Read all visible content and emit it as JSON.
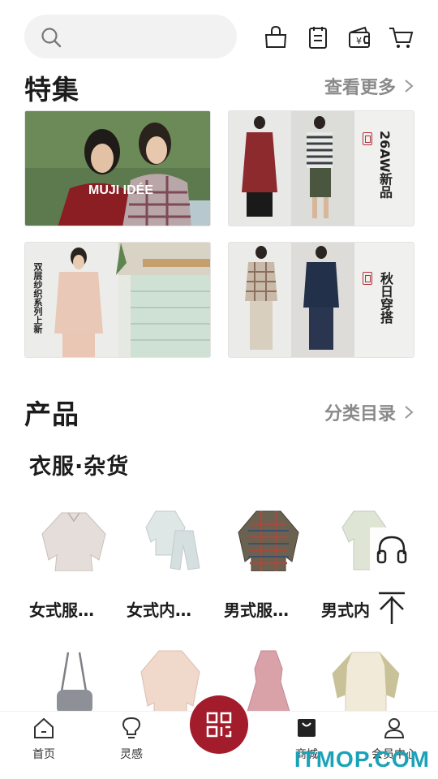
{
  "header": {
    "search_icon": "search-icon",
    "icons": [
      "shopping-bag-icon",
      "notepad-icon",
      "wallet-icon",
      "cart-icon"
    ]
  },
  "featured": {
    "title": "特集",
    "more_label": "查看更多",
    "cards": [
      {
        "label": "MUJI IDÉE"
      },
      {
        "label": "26AW新品"
      },
      {
        "label": "双层纱织系列上新"
      },
      {
        "label": "秋日穿搭"
      }
    ]
  },
  "products": {
    "title": "产品",
    "more_label": "分类目录",
    "subcategory": "衣服·杂货",
    "items": [
      {
        "name": "女式服…"
      },
      {
        "name": "女式内…"
      },
      {
        "name": "男式服…"
      },
      {
        "name": "男式内"
      }
    ]
  },
  "bottom_nav": {
    "items": [
      {
        "label": "首页",
        "icon": "home-icon"
      },
      {
        "label": "灵感",
        "icon": "lightbulb-icon"
      },
      {
        "label": "",
        "icon": "qr-code-icon"
      },
      {
        "label": "商城",
        "icon": "shop-bag-icon"
      },
      {
        "label": "会员中心",
        "icon": "user-icon"
      }
    ]
  },
  "watermark": "ITMOP.COM",
  "colors": {
    "accent": "#a31c2b",
    "muted_text": "#8a8a8a",
    "search_bg": "#f2f2f2"
  }
}
